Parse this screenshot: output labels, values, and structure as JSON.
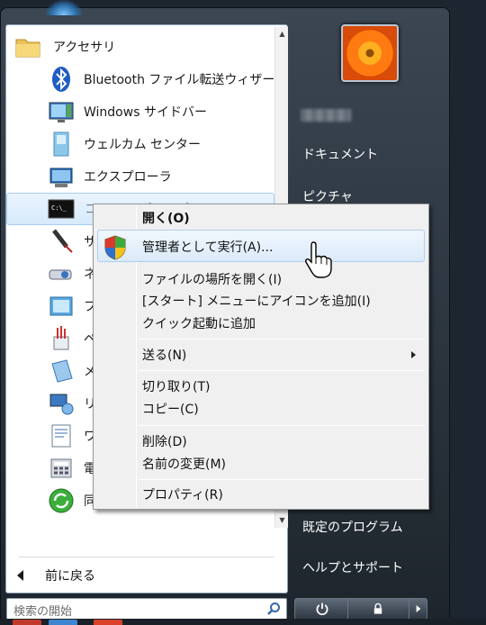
{
  "programs": [
    {
      "label": "アクセサリ",
      "icon": "folder-icon"
    },
    {
      "label": "Bluetooth ファイル転送ウィザー",
      "icon": "bluetooth-icon"
    },
    {
      "label": "Windows サイドバー",
      "icon": "sidebar-icon"
    },
    {
      "label": "ウェルカム センター",
      "icon": "welcome-center-icon"
    },
    {
      "label": "エクスプローラ",
      "icon": "explorer-icon"
    },
    {
      "label": "コマンド プロンプト",
      "icon": "command-prompt-icon"
    },
    {
      "label": "サ",
      "icon": "microphone-icon"
    },
    {
      "label": "ネ",
      "icon": "projector-icon"
    },
    {
      "label": "フ",
      "icon": "tablet-icon"
    },
    {
      "label": "ペ",
      "icon": "paint-icon"
    },
    {
      "label": "メ",
      "icon": "notepad-icon"
    },
    {
      "label": "リ",
      "icon": "remote-desktop-icon"
    },
    {
      "label": "ワ",
      "icon": "wordpad-icon"
    },
    {
      "label": "電",
      "icon": "calculator-icon"
    },
    {
      "label": "同",
      "icon": "sync-center-icon"
    }
  ],
  "back_label": "前に戻る",
  "search": {
    "placeholder": "検索の開始"
  },
  "right_items": {
    "documents": "ドキュメント",
    "pictures": "ピクチャ",
    "default_programs": "既定のプログラム",
    "help": "ヘルプとサポート"
  },
  "context_menu": {
    "open": "開く(O)",
    "run_as_admin": "管理者として実行(A)...",
    "open_location": "ファイルの場所を開く(I)",
    "pin_start": "[スタート] メニューにアイコンを追加(I)",
    "add_quick_launch": "クイック起動に追加",
    "send_to": "送る(N)",
    "cut": "切り取り(T)",
    "copy": "コピー(C)",
    "delete": "削除(D)",
    "rename": "名前の変更(M)",
    "properties": "プロパティ(R)"
  },
  "colors": {
    "accent": "#2a6ea8",
    "panel_bg": "#2f3843",
    "hover": "#dbeaf9"
  }
}
